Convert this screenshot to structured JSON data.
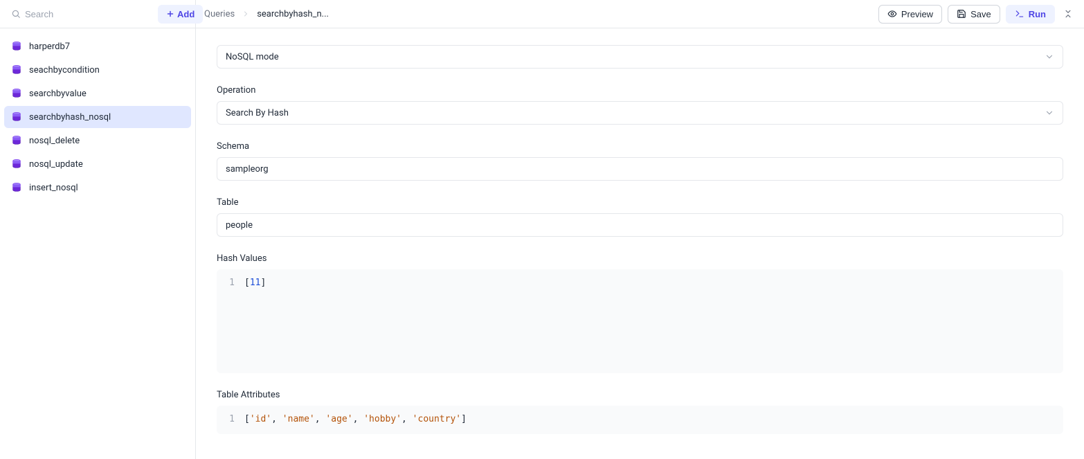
{
  "sidebar": {
    "search_placeholder": "Search",
    "add_button": "Add",
    "items": [
      {
        "label": "harperdb7",
        "active": false
      },
      {
        "label": "seachbycondition",
        "active": false
      },
      {
        "label": "searchbyvalue",
        "active": false
      },
      {
        "label": "searchbyhash_nosql",
        "active": true
      },
      {
        "label": "nosql_delete",
        "active": false
      },
      {
        "label": "nosql_update",
        "active": false
      },
      {
        "label": "insert_nosql",
        "active": false
      }
    ]
  },
  "breadcrumb": {
    "root": "Queries",
    "current": "searchbyhash_n..."
  },
  "actions": {
    "preview": "Preview",
    "save": "Save",
    "run": "Run"
  },
  "form": {
    "mode": {
      "value": "NoSQL mode"
    },
    "operation": {
      "label": "Operation",
      "value": "Search By Hash"
    },
    "schema": {
      "label": "Schema",
      "value": "sampleorg"
    },
    "table": {
      "label": "Table",
      "value": "people"
    },
    "hash_values": {
      "label": "Hash Values",
      "line_number": "1",
      "code": {
        "open": "[",
        "num": "11",
        "close": "]"
      }
    },
    "table_attributes": {
      "label": "Table Attributes",
      "line_number": "1",
      "code": {
        "open": "[",
        "items": [
          "'id'",
          "'name'",
          "'age'",
          "'hobby'",
          "'country'"
        ],
        "sep": ", ",
        "close": "]"
      }
    }
  }
}
